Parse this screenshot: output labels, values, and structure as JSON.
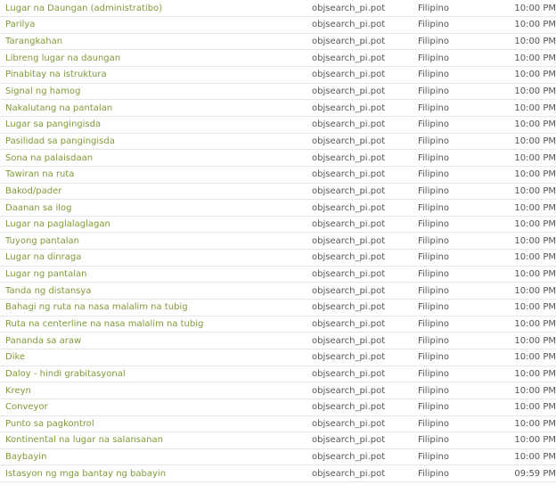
{
  "rows": [
    {
      "name": "Lugar na Daungan (administratibo)",
      "file": "objsearch_pi.pot",
      "language": "Filipino",
      "time": "10:00 PM"
    },
    {
      "name": "Parilya",
      "file": "objsearch_pi.pot",
      "language": "Filipino",
      "time": "10:00 PM"
    },
    {
      "name": "Tarangkahan",
      "file": "objsearch_pi.pot",
      "language": "Filipino",
      "time": "10:00 PM"
    },
    {
      "name": "Libreng lugar na daungan",
      "file": "objsearch_pi.pot",
      "language": "Filipino",
      "time": "10:00 PM"
    },
    {
      "name": "Pinabitay na istruktura",
      "file": "objsearch_pi.pot",
      "language": "Filipino",
      "time": "10:00 PM"
    },
    {
      "name": "Signal ng hamog",
      "file": "objsearch_pi.pot",
      "language": "Filipino",
      "time": "10:00 PM"
    },
    {
      "name": "Nakalutang na pantalan",
      "file": "objsearch_pi.pot",
      "language": "Filipino",
      "time": "10:00 PM"
    },
    {
      "name": "Lugar sa pangingisda",
      "file": "objsearch_pi.pot",
      "language": "Filipino",
      "time": "10:00 PM"
    },
    {
      "name": "Pasilidad sa pangingisda",
      "file": "objsearch_pi.pot",
      "language": "Filipino",
      "time": "10:00 PM"
    },
    {
      "name": "Sona na palaisdaan",
      "file": "objsearch_pi.pot",
      "language": "Filipino",
      "time": "10:00 PM"
    },
    {
      "name": "Tawiran na ruta",
      "file": "objsearch_pi.pot",
      "language": "Filipino",
      "time": "10:00 PM"
    },
    {
      "name": "Bakod/pader",
      "file": "objsearch_pi.pot",
      "language": "Filipino",
      "time": "10:00 PM"
    },
    {
      "name": "Daanan sa ilog",
      "file": "objsearch_pi.pot",
      "language": "Filipino",
      "time": "10:00 PM"
    },
    {
      "name": "Lugar na paglalaglagan",
      "file": "objsearch_pi.pot",
      "language": "Filipino",
      "time": "10:00 PM"
    },
    {
      "name": "Tuyong pantalan",
      "file": "objsearch_pi.pot",
      "language": "Filipino",
      "time": "10:00 PM"
    },
    {
      "name": "Lugar na dinraga",
      "file": "objsearch_pi.pot",
      "language": "Filipino",
      "time": "10:00 PM"
    },
    {
      "name": "Lugar ng pantalan",
      "file": "objsearch_pi.pot",
      "language": "Filipino",
      "time": "10:00 PM"
    },
    {
      "name": "Tanda ng distansya",
      "file": "objsearch_pi.pot",
      "language": "Filipino",
      "time": "10:00 PM"
    },
    {
      "name": "Bahagi ng ruta na nasa malalim na tubig",
      "file": "objsearch_pi.pot",
      "language": "Filipino",
      "time": "10:00 PM"
    },
    {
      "name": "Ruta na centerline na nasa malalim na tubig",
      "file": "objsearch_pi.pot",
      "language": "Filipino",
      "time": "10:00 PM"
    },
    {
      "name": "Pananda sa araw",
      "file": "objsearch_pi.pot",
      "language": "Filipino",
      "time": "10:00 PM"
    },
    {
      "name": "Dike",
      "file": "objsearch_pi.pot",
      "language": "Filipino",
      "time": "10:00 PM"
    },
    {
      "name": "Daloy - hindi grabitasyonal",
      "file": "objsearch_pi.pot",
      "language": "Filipino",
      "time": "10:00 PM"
    },
    {
      "name": "Kreyn",
      "file": "objsearch_pi.pot",
      "language": "Filipino",
      "time": "10:00 PM"
    },
    {
      "name": "Conveyor",
      "file": "objsearch_pi.pot",
      "language": "Filipino",
      "time": "10:00 PM"
    },
    {
      "name": "Punto sa pagkontrol",
      "file": "objsearch_pi.pot",
      "language": "Filipino",
      "time": "10:00 PM"
    },
    {
      "name": "Kontinental na lugar na salansanan",
      "file": "objsearch_pi.pot",
      "language": "Filipino",
      "time": "10:00 PM"
    },
    {
      "name": "Baybayin",
      "file": "objsearch_pi.pot",
      "language": "Filipino",
      "time": "10:00 PM"
    },
    {
      "name": "Istasyon ng mga bantay ng babayin",
      "file": "objsearch_pi.pot",
      "language": "Filipino",
      "time": "09:59 PM"
    }
  ],
  "colors": {
    "link": "#7f9a37",
    "text": "#555555",
    "divider": "#e6e6e6",
    "background": "#ffffff"
  }
}
